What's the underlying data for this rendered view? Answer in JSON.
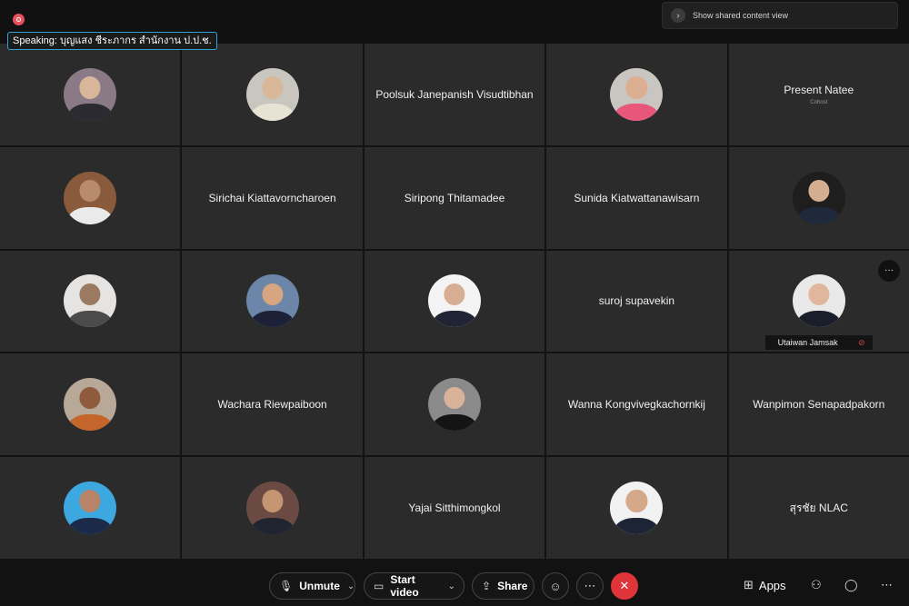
{
  "header": {
    "speaking": "Speaking: บุญแสง ชีระภากร สำนักงาน ป.ป.ช.",
    "shared_content_label": "Show shared content view"
  },
  "tiles": [
    {
      "name": "",
      "has_avatar": true
    },
    {
      "name": "",
      "has_avatar": true
    },
    {
      "name": "Poolsuk Janepanish Visudtibhan",
      "has_avatar": false
    },
    {
      "name": "",
      "has_avatar": true
    },
    {
      "name": "Present Natee",
      "subtitle": "Cohost",
      "has_avatar": false
    },
    {
      "name": "",
      "has_avatar": true
    },
    {
      "name": "Sirichai Kiattavorncharoen",
      "has_avatar": false
    },
    {
      "name": "Siripong Thitamadee",
      "has_avatar": false
    },
    {
      "name": "Sunida Kiatwattanawisarn",
      "has_avatar": false
    },
    {
      "name": "",
      "has_avatar": true
    },
    {
      "name": "",
      "has_avatar": true
    },
    {
      "name": "",
      "has_avatar": true
    },
    {
      "name": "",
      "has_avatar": true
    },
    {
      "name": "suroj supavekin",
      "has_avatar": false
    },
    {
      "name": "",
      "has_avatar": true,
      "name_tag": "Utaiwan Jamsak",
      "muted": true,
      "more_button": true
    },
    {
      "name": "",
      "has_avatar": true
    },
    {
      "name": "Wachara Riewpaiboon",
      "has_avatar": false
    },
    {
      "name": "",
      "has_avatar": true
    },
    {
      "name": "Wanna Kongvivegkachornkij",
      "has_avatar": false
    },
    {
      "name": "Wanpimon Senapadpakorn",
      "has_avatar": false
    },
    {
      "name": "",
      "has_avatar": true
    },
    {
      "name": "",
      "has_avatar": true
    },
    {
      "name": "Yajai Sitthimongkol",
      "has_avatar": false
    },
    {
      "name": "",
      "has_avatar": true
    },
    {
      "name": "สุรชัย NLAC",
      "has_avatar": false
    }
  ],
  "controls": {
    "unmute": "Unmute",
    "start_video": "Start video",
    "share": "Share",
    "apps": "Apps"
  },
  "colors": {
    "leave_button": "#e0343b",
    "speaking_border": "#2fa3d6",
    "tile_bg": "#2b2b2b"
  }
}
